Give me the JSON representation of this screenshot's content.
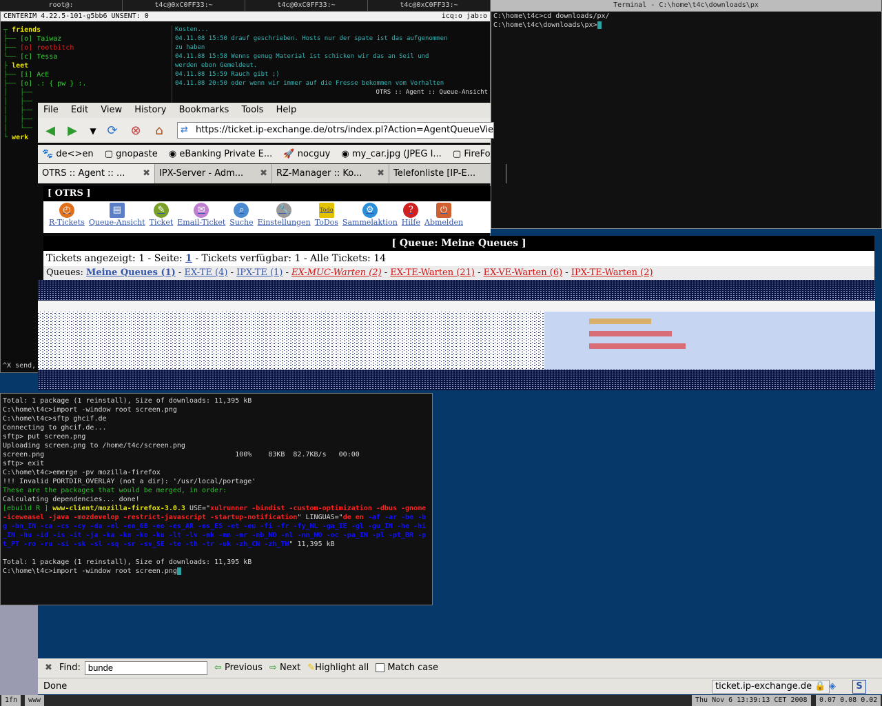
{
  "topbar": {
    "tabs": [
      "root@:",
      "t4c@0xC0FF33:~",
      "t4c@0xC0FF33:~",
      "t4c@0xC0FF33:~",
      "Terminal - C:\\home\\t4c\\downloads\\px"
    ]
  },
  "terminal_right": {
    "lines": [
      "C:\\home\\t4c>cd downloads/px/",
      "C:\\home\\t4c\\downloads\\px>"
    ]
  },
  "centerim": {
    "title": "CENTERIM 4.22.5-101-g5bb6   UNSENT: 0",
    "status_right": "icq:o jab:o",
    "tree": {
      "group1": "friends",
      "contacts1": [
        {
          "prefix": "[o]",
          "name": "Taiwaz",
          "color": "green"
        },
        {
          "prefix": "[o]",
          "name": "rootbitch",
          "color": "red"
        },
        {
          "prefix": "[c]",
          "name": "Tessa",
          "color": "green"
        }
      ],
      "group2": "leet",
      "contacts2": [
        {
          "prefix": "[i]",
          "name": "AcE",
          "color": "green"
        },
        {
          "prefix": "[o]",
          "name": ".: { pw } :.",
          "color": "green"
        }
      ],
      "group3": "werk"
    },
    "send_hint": "^X send,",
    "log_lines": [
      "Kosten...",
      "04.11.08 15:50 drauf geschrieben. Hosts nur der spate ist das aufgenommen",
      "zu haben",
      "04.11.08 15:58 Wenns genug Material ist schicken wir das an Seil und",
      "werden ebon Gemeldeut.",
      "04.11.08 15:59 Rauch gibt ;)",
      "04.11.08 20:50 oder wenn wir immer auf die Fresse bekommen vom Vorhalten",
      "OTRS :: Agent :: Queue-Ansicht"
    ]
  },
  "firefox": {
    "menu": [
      "File",
      "Edit",
      "View",
      "History",
      "Bookmarks",
      "Tools",
      "Help"
    ],
    "url": "https://ticket.ip-exchange.de/otrs/index.pl?Action=AgentQueueView&Se",
    "bookmarks": [
      "de<>en",
      "gnopaste",
      "eBanking Private E...",
      "nocguy",
      "my_car.jpg (JPEG I...",
      "FireFox-Prefetc"
    ],
    "tabs": [
      "OTRS :: Agent :: ...",
      "IPX-Server - Adm...",
      "RZ-Manager :: Ko...",
      "Telefonliste [IP-E..."
    ],
    "find": {
      "label": "Find:",
      "value": "bunde",
      "previous": "Previous",
      "next": "Next",
      "highlight": "Highlight all",
      "match_case": "Match case"
    },
    "status": "Done",
    "status_host": "ticket.ip-exchange.de"
  },
  "otrs": {
    "header": "[ OTRS ]",
    "nav": [
      {
        "label": "R-Tickets",
        "icon": "clock-icon",
        "color": "#e0701a"
      },
      {
        "label": "Queue-Ansicht",
        "icon": "window-icon",
        "color": "#5b7fc7"
      },
      {
        "label": "Ticket",
        "icon": "ticket-icon",
        "color": "#7aa02a"
      },
      {
        "label": "Email-Ticket",
        "icon": "email-icon",
        "color": "#c07fd0"
      },
      {
        "label": "Suche",
        "icon": "search-icon",
        "color": "#4a8ad0"
      },
      {
        "label": "Einstellungen",
        "icon": "wrench-icon",
        "color": "#999999"
      },
      {
        "label": "ToDos",
        "icon": "todo-icon",
        "color": "#e5c200"
      },
      {
        "label": "Sammelaktion",
        "icon": "gear-icon",
        "color": "#2a8fd9"
      },
      {
        "label": "Hilfe",
        "icon": "help-icon",
        "color": "#d02020"
      },
      {
        "label": "Abmelden",
        "icon": "logout-icon",
        "color": "#d06030"
      }
    ],
    "queue_title": "[ Queue: Meine Queues ]",
    "info": {
      "prefix": "Tickets angezeigt: 1 - Seite:",
      "page": "1",
      "suffix": "- Tickets verfügbar: 1 - Alle Tickets: 14"
    },
    "queues_label": "Queues:",
    "queues": [
      {
        "label": "Meine Queues (1)",
        "style": "bold"
      },
      {
        "label": "EX-TE (4)",
        "style": "link"
      },
      {
        "label": "IPX-TE (1)",
        "style": "link"
      },
      {
        "label": "EX-MUC-Warten (2)",
        "style": "red-italic"
      },
      {
        "label": "EX-TE-Warten (21)",
        "style": "red"
      },
      {
        "label": "EX-VE-Warten (6)",
        "style": "red"
      },
      {
        "label": "IPX-TE-Warten (2)",
        "style": "red"
      }
    ]
  },
  "terminal_bottom": {
    "lines": [
      {
        "t": "Total: 1 package (1 reinstall), Size of downloads: 11,395 kB",
        "c": ""
      },
      {
        "t": "C:\\home\\t4c>import -window root screen.png",
        "c": ""
      },
      {
        "t": "C:\\home\\t4c>sftp ghcif.de",
        "c": ""
      },
      {
        "t": "Connecting to ghcif.de...",
        "c": ""
      },
      {
        "t": "sftp> put screen.png",
        "c": ""
      },
      {
        "t": "Uploading screen.png to /home/t4c/screen.png",
        "c": ""
      },
      {
        "t": "screen.png                                              100%    83KB  82.7KB/s   00:00",
        "c": ""
      },
      {
        "t": "sftp> exit",
        "c": ""
      },
      {
        "t": "C:\\home\\t4c>emerge -pv mozilla-firefox",
        "c": ""
      },
      {
        "t": "!!! Invalid PORTDIR_OVERLAY (not a dir): '/usr/local/portage'",
        "c": ""
      },
      {
        "t": "",
        "c": ""
      },
      {
        "t": "These are the packages that would be merged, in order:",
        "c": "green"
      },
      {
        "t": "",
        "c": ""
      },
      {
        "t": "Calculating dependencies... done!",
        "c": ""
      }
    ],
    "ebuild_prefix": "[ebuild   R   ]",
    "ebuild_pkg": "www-client/mozilla-firefox-3.0.3",
    "ebuild_use": " USE=\"",
    "ebuild_flags": "xulrunner -bindist -custom-optimization -dbus -gnome -iceweasel -java -mozdevelop -restrict-javascript -startup-notification",
    "ebuild_linguas": "\" LINGUAS=\"",
    "ebuild_langs_red": "de en",
    "ebuild_langs_blue": "-af -ar -be -bg -bn_IN -ca -cs -cy -da -el -en_GB -eo -es_AR -es_ES -et -eu -fi -fr -fy_NL -ga_IE -gl -gu_IN -he -hi_IN -hu -id -is -it -ja -ka -kn -ko -ku -lt -lv -mk -mn -mr -nb_NO -nl -nn_NO -oc -pa_IN -pl -pt_BR -pt_PT -ro -ru -si -sk -sl -sq -sr -sv_SE -te -th -tr -uk -zh_CN -zh_TW",
    "ebuild_size": "\" 11,395 kB",
    "footer": [
      "",
      "Total: 1 package (1 reinstall), Size of downloads: 11,395 kB",
      "C:\\home\\t4c>import -window root screen.png"
    ]
  },
  "bottombar": {
    "left1": "1fn",
    "left2": "www",
    "clock": "Thu Nov  6 13:39:13 CET 2008",
    "load": "0.07 0.08 0.02"
  }
}
